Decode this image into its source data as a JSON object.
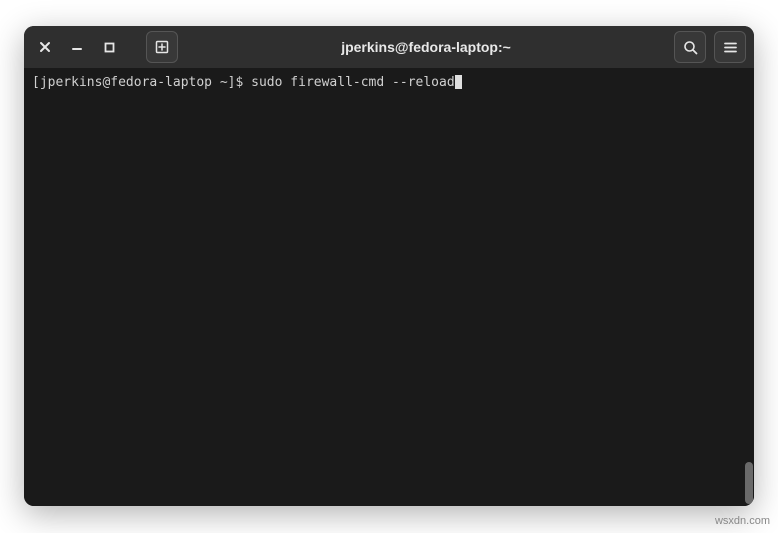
{
  "window": {
    "title": "jperkins@fedora-laptop:~"
  },
  "terminal": {
    "prompt": "[jperkins@fedora-laptop ~]$ ",
    "command": "sudo firewall-cmd --reload"
  },
  "watermark": "wsxdn.com"
}
